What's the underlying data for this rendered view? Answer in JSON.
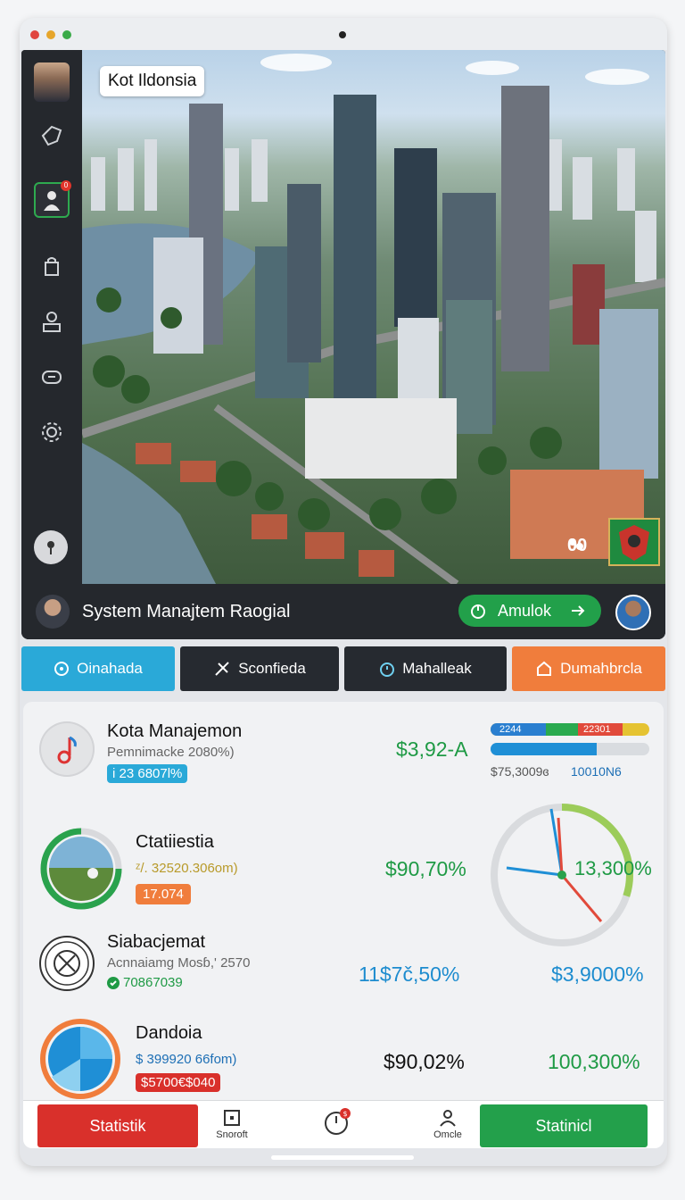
{
  "hero": {
    "city_label": "Kot Ildonsia",
    "city_count": "00",
    "bar_title": "System Manajtem Raogial",
    "action_button": "Amulok"
  },
  "tabs": [
    {
      "label": "Oinahada",
      "icon": "refresh-icon",
      "color": "#2aa9d8"
    },
    {
      "label": "Sconfieda",
      "icon": "tools-icon",
      "color": "#262a30"
    },
    {
      "label": "Mahalleak",
      "icon": "timer-icon",
      "color": "#262a30"
    },
    {
      "label": "Dumahbrcla",
      "icon": "home-icon",
      "color": "#f07d3c"
    }
  ],
  "rows": [
    {
      "title": "Kota Manajemon",
      "sub": "Pemnimacke 2080%)",
      "pill": "i 23 6807l%",
      "value": "$3,92-A"
    },
    {
      "title": "Ctatiiestia",
      "sub": "ᶻ/. 32520.306om)",
      "pill": "17.074",
      "value": "$90,70%"
    },
    {
      "title": "Siabacjemat",
      "sub": "Acnnaiamg Mosɓ,' 2570",
      "pill": "70867039",
      "value": "11$7č,50%",
      "value2": "$3,9000%"
    },
    {
      "title": "Dandoia",
      "sub": "$ 399920 66fom)",
      "pill": "$5700€$040",
      "value": "$90,02%",
      "value2": "100,300%"
    }
  ],
  "progress": {
    "seg_blue": "2244",
    "seg_red": "22301",
    "left_text": "$75,3009ɞ",
    "right_text": "10010N6",
    "bar2_fill": 0.67
  },
  "gauge": {
    "label": "13,300%",
    "level": 0.3
  },
  "bottom": {
    "left_button": "Statistik",
    "item1": "Snoroft",
    "item3": "Omcle",
    "right_button": "Statinicl",
    "badge": "$"
  },
  "colors": {
    "accent_green": "#23a04b",
    "accent_red": "#d9302b",
    "accent_blue": "#2aa9d8",
    "accent_orange": "#f07d3c"
  }
}
